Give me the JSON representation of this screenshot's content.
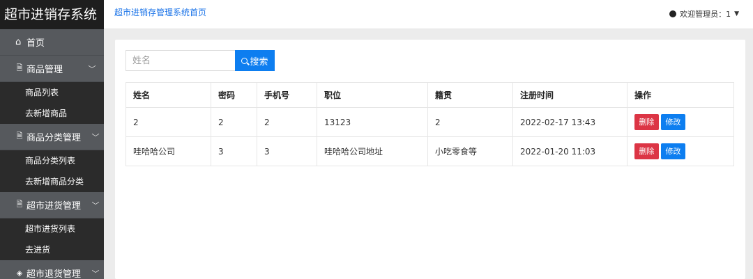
{
  "app_title": "超市进销存系统",
  "breadcrumb": "超市进销存管理系统首页",
  "user_label": "欢迎管理员：1",
  "sidebar": {
    "home": "首页",
    "groups": [
      {
        "label": "商品管理",
        "items": [
          "商品列表",
          "去新增商品"
        ]
      },
      {
        "label": "商品分类管理",
        "items": [
          "商品分类列表",
          "去新增商品分类"
        ]
      },
      {
        "label": "超市进货管理",
        "items": [
          "超市进货列表",
          "去进货"
        ]
      },
      {
        "label": "超市退货管理",
        "items": []
      }
    ]
  },
  "search": {
    "placeholder": "姓名",
    "button": "搜索"
  },
  "table": {
    "headers": [
      "姓名",
      "密码",
      "手机号",
      "职位",
      "籍贯",
      "注册时间",
      "操作"
    ],
    "rows": [
      [
        "2",
        "2",
        "2",
        "13123",
        "2",
        "2022-02-17 13:43"
      ],
      [
        "哇哈哈公司",
        "3",
        "3",
        "哇哈哈公司地址",
        "小吃零食等",
        "2022-01-20 11:03"
      ]
    ],
    "delete_label": "删除",
    "edit_label": "修改"
  },
  "colors": {
    "primary": "#0d7ef0",
    "danger": "#dc3545",
    "sidebar_bg": "#2b2b2b",
    "sidebar_group": "#56595d"
  }
}
